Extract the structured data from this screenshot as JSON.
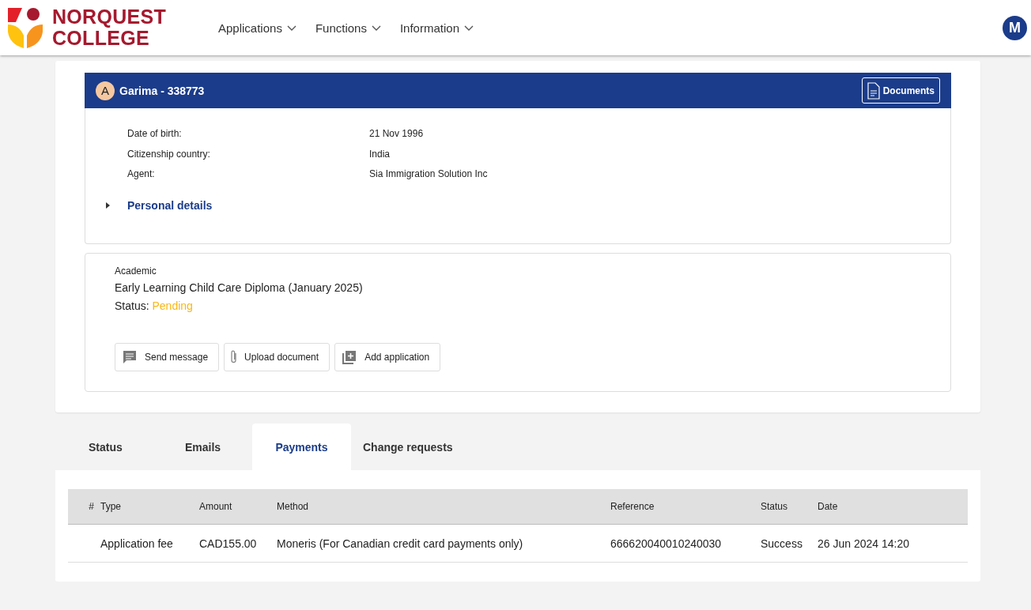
{
  "header": {
    "logo": {
      "line_1": "NORQUEST",
      "line_2": "COLLEGE"
    },
    "nav": [
      {
        "label": "Applications"
      },
      {
        "label": "Functions"
      },
      {
        "label": "Information"
      }
    ],
    "avatar": "M"
  },
  "applicant": {
    "initial": "A",
    "name": "Garima - 338773",
    "documents_button": "Documents",
    "fields": [
      {
        "label": "Date of birth:",
        "value": "21 Nov 1996"
      },
      {
        "label": "Citizenship country:",
        "value": "India"
      },
      {
        "label": "Agent:",
        "value": "Sia Immigration Solution Inc"
      }
    ],
    "personal_details": {
      "label": "Personal details",
      "expanded": false
    }
  },
  "application": {
    "category": "Academic",
    "program": "Early Learning Child Care Diploma (January 2025)",
    "status_label": "Status:",
    "status": "Pending",
    "actions": [
      {
        "label": "Send message",
        "kind": "message"
      },
      {
        "label": "Upload document",
        "kind": "attach"
      },
      {
        "label": "Add application",
        "kind": "add"
      }
    ]
  },
  "tabs": [
    {
      "label": "Status",
      "selected": false
    },
    {
      "label": "Emails",
      "selected": false
    },
    {
      "label": "Payments",
      "selected": true
    },
    {
      "label": "Change requests",
      "selected": false
    }
  ],
  "payments": {
    "columns": [
      "#",
      "Type",
      "Amount",
      "Method",
      "Reference",
      "Status",
      "Date"
    ],
    "rows": [
      {
        "type": "Application fee",
        "amount": "CAD155.00",
        "method": "Moneris (For Canadian credit card payments only)",
        "reference": "666620040010240030",
        "status": "Success",
        "date": "26 Jun 2024 14:20"
      }
    ]
  }
}
